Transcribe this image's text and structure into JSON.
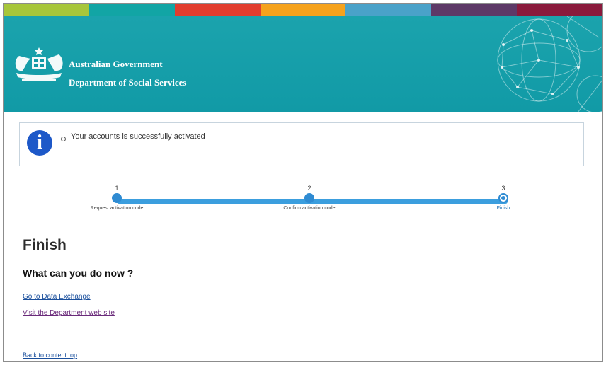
{
  "header": {
    "stripe_colors": [
      "#a7c63b",
      "#12a5a5",
      "#e23d2e",
      "#f5a21c",
      "#4aa2c9",
      "#5d3967",
      "#8a1a3c"
    ],
    "org_line1": "Australian Government",
    "org_line2": "Department of Social Services",
    "crest_icon": "coat-of-arms-icon"
  },
  "alert": {
    "icon": "info-icon",
    "icon_glyph": "i",
    "message": "Your accounts is successfully activated"
  },
  "steps": [
    {
      "number": "1",
      "label": "Request activation code",
      "state": "complete"
    },
    {
      "number": "2",
      "label": "Confirm activation code",
      "state": "complete"
    },
    {
      "number": "3",
      "label": "Finish",
      "state": "current"
    }
  ],
  "main": {
    "title": "Finish",
    "subtitle": "What can you do now ?",
    "links": {
      "data_exchange": "Go to Data Exchange",
      "department_site": "Visit the Department web site",
      "back_to_top": "Back to content top"
    }
  }
}
